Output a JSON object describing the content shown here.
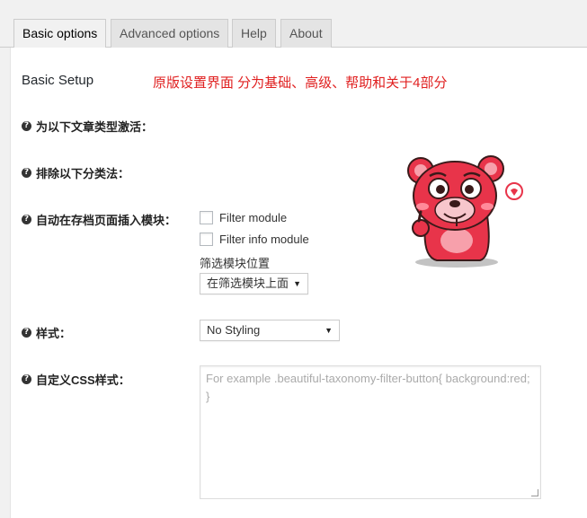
{
  "tabs": [
    {
      "label": "Basic options",
      "active": true
    },
    {
      "label": "Advanced options",
      "active": false
    },
    {
      "label": "Help",
      "active": false
    },
    {
      "label": "About",
      "active": false
    }
  ],
  "section": {
    "title": "Basic Setup",
    "note": "原版设置界面 分为基础、高级、帮助和关于4部分"
  },
  "fields": {
    "post_types_label": "为以下文章类型激活：",
    "exclude_label": "排除以下分类法：",
    "auto_insert_label": "自动在存档页面插入模块：",
    "filter_module_label": "Filter module",
    "filter_info_label": "Filter info module",
    "position_label": "筛选模块位置",
    "position_value": "在筛选模块上面",
    "style_label": "样式：",
    "style_value": "No Styling",
    "css_label": "自定义CSS样式：",
    "css_placeholder": "For example .beautiful-taxonomy-filter-button{ background:red; }"
  },
  "icons": {
    "help": "question-circle-icon",
    "dropdown": "caret-down-icon",
    "mascot": "red-bear-mascot"
  },
  "colors": {
    "note": "#e02020",
    "mascot": "#e8344a"
  }
}
